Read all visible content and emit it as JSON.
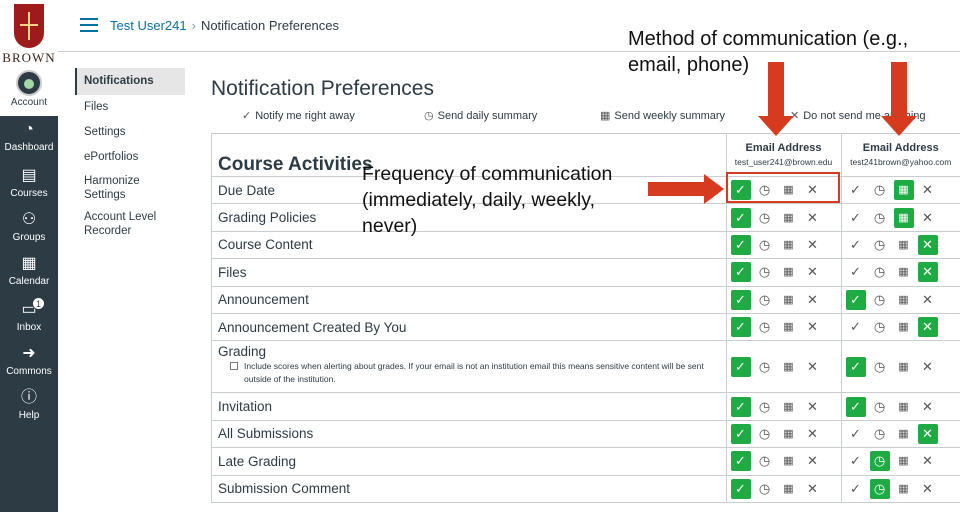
{
  "brand": {
    "name": "BROWN"
  },
  "global_nav": [
    {
      "label": "Account",
      "icon": "account-avatar"
    },
    {
      "label": "Dashboard",
      "icon": "dashboard-icon"
    },
    {
      "label": "Courses",
      "icon": "courses-icon"
    },
    {
      "label": "Groups",
      "icon": "groups-icon"
    },
    {
      "label": "Calendar",
      "icon": "calendar-icon"
    },
    {
      "label": "Inbox",
      "icon": "inbox-icon",
      "badge": "1"
    },
    {
      "label": "Commons",
      "icon": "commons-icon"
    },
    {
      "label": "Help",
      "icon": "help-icon"
    }
  ],
  "breadcrumb": {
    "user": "Test User241",
    "separator": "›",
    "page": "Notification Preferences"
  },
  "course_nav": [
    "Notifications",
    "Files",
    "Settings",
    "ePortfolios",
    "Harmonize Settings",
    "Account Level Recorder"
  ],
  "page_title": "Notification Preferences",
  "legend": {
    "right_away": "Notify me right away",
    "daily": "Send daily summary",
    "weekly": "Send weekly summary",
    "never": "Do not send me anything"
  },
  "table": {
    "section_title": "Course Activities",
    "channels": [
      {
        "type": "Email Address",
        "address": "test_user241@brown.edu"
      },
      {
        "type": "Email Address",
        "address": "test241brown@yahoo.com"
      }
    ],
    "rows": [
      {
        "name": "Due Date",
        "sel": [
          "immediate",
          "weekly"
        ]
      },
      {
        "name": "Grading Policies",
        "sel": [
          "immediate",
          "weekly"
        ]
      },
      {
        "name": "Course Content",
        "sel": [
          "immediate",
          "never"
        ]
      },
      {
        "name": "Files",
        "sel": [
          "immediate",
          "never"
        ]
      },
      {
        "name": "Announcement",
        "sel": [
          "immediate",
          "immediate"
        ]
      },
      {
        "name": "Announcement Created By You",
        "sel": [
          "immediate",
          "never"
        ]
      },
      {
        "name": "Grading",
        "sel": [
          "immediate",
          "immediate"
        ],
        "note": "Include scores when alerting about grades. If your email is not an institution email this means sensitive content will be sent outside of the institution."
      },
      {
        "name": "Invitation",
        "sel": [
          "immediate",
          "immediate"
        ]
      },
      {
        "name": "All Submissions",
        "sel": [
          "immediate",
          "never"
        ]
      },
      {
        "name": "Late Grading",
        "sel": [
          "immediate",
          "daily"
        ]
      },
      {
        "name": "Submission Comment",
        "sel": [
          "immediate",
          "daily"
        ]
      }
    ]
  },
  "annotations": {
    "method": "Method of communication (e.g., email, phone)",
    "frequency": "Frequency of communication (immediately, daily, weekly, never)",
    "accent": "#d63b1f"
  },
  "colors": {
    "selected": "#1fab43",
    "nav_bg": "#2d3b45",
    "link": "#0770a3"
  }
}
